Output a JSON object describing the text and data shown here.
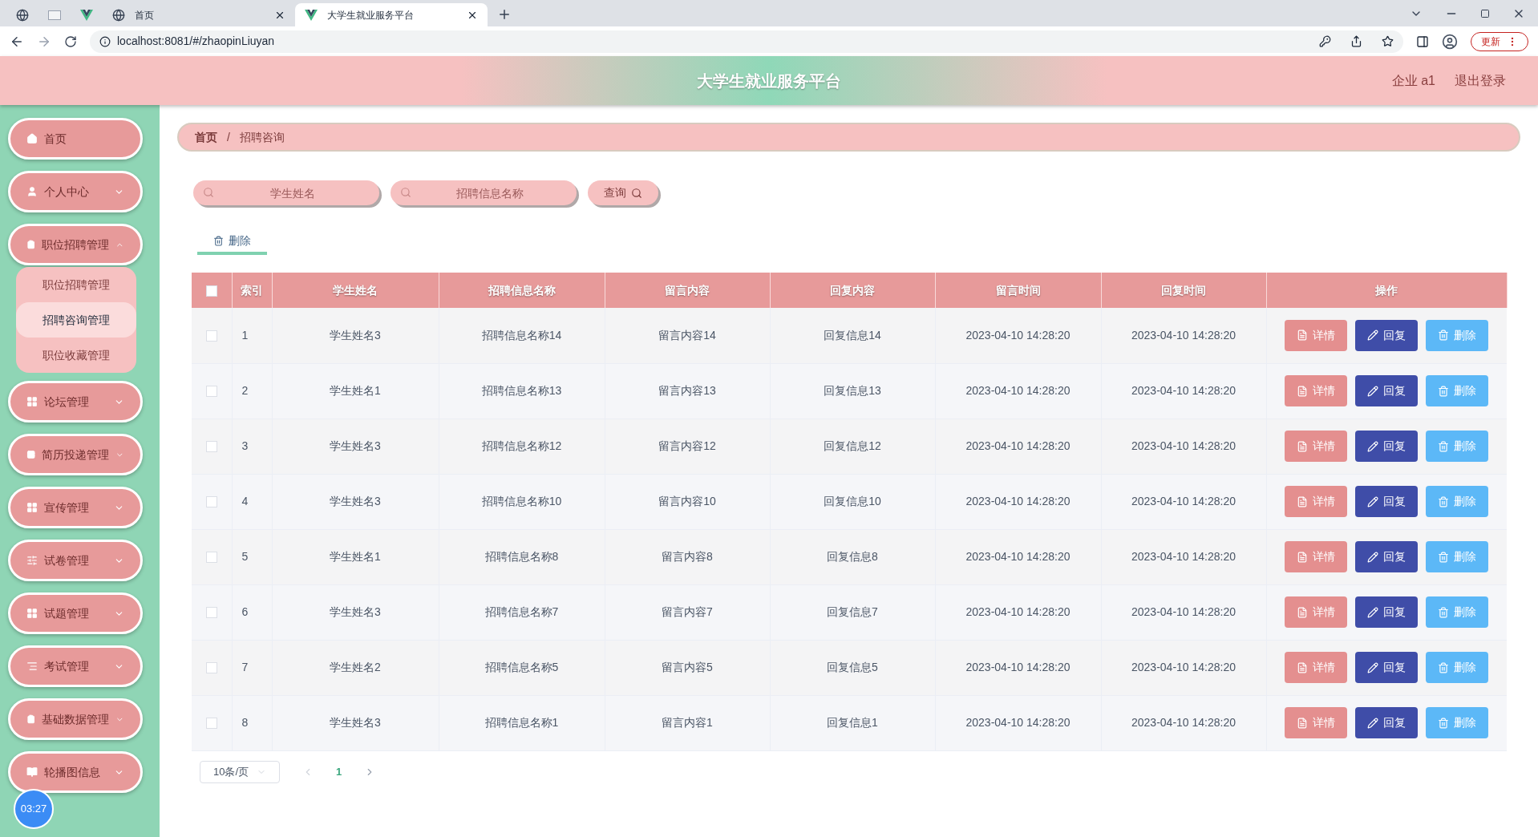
{
  "browser": {
    "tabs": [
      {
        "selected": false
      },
      {
        "selected": false
      },
      {
        "selected": false
      },
      {
        "title": "首页",
        "selected": false
      },
      {
        "title": "大学生就业服务平台",
        "selected": true
      }
    ],
    "url": "localhost:8081/#/zhaopinLiuyan",
    "update_button": "更新"
  },
  "header": {
    "title": "大学生就业服务平台",
    "user": "企业 a1",
    "logout": "退出登录"
  },
  "sidebar": {
    "items": [
      {
        "label": "首页"
      },
      {
        "label": "个人中心",
        "expanded": false
      },
      {
        "label": "职位招聘管理",
        "expanded": true,
        "children": [
          {
            "label": "职位招聘管理",
            "selected": false
          },
          {
            "label": "招聘咨询管理",
            "selected": true
          },
          {
            "label": "职位收藏管理",
            "selected": false
          }
        ]
      },
      {
        "label": "论坛管理",
        "expanded": false
      },
      {
        "label": "简历投递管理",
        "expanded": false
      },
      {
        "label": "宣传管理",
        "expanded": false
      },
      {
        "label": "试卷管理",
        "expanded": false
      },
      {
        "label": "试题管理",
        "expanded": false
      },
      {
        "label": "考试管理",
        "expanded": false
      },
      {
        "label": "基础数据管理",
        "expanded": false
      },
      {
        "label": "轮播图信息",
        "expanded": false
      }
    ],
    "clock": "03:27"
  },
  "breadcrumb": {
    "items": [
      "首页",
      "招聘咨询"
    ],
    "separator": "/"
  },
  "search": {
    "fields": [
      {
        "placeholder": "学生姓名"
      },
      {
        "placeholder": "招聘信息名称"
      }
    ],
    "button": "查询"
  },
  "toolbar": {
    "delete_button": "删除"
  },
  "table": {
    "columns": [
      "索引",
      "学生姓名",
      "招聘信息名称",
      "留言内容",
      "回复内容",
      "留言时间",
      "回复时间",
      "操作"
    ],
    "all_checked": false,
    "rows": [
      {
        "checked": false,
        "cells": [
          "1",
          "学生姓名3",
          "招聘信息名称14",
          "留言内容14",
          "回复信息14",
          "2023-04-10 14:28:20",
          "2023-04-10 14:28:20"
        ],
        "actions": [
          {
            "kind": "detail",
            "label": "详情"
          },
          {
            "kind": "reply",
            "label": "回复"
          },
          {
            "kind": "delete",
            "label": "删除"
          }
        ]
      },
      {
        "checked": false,
        "cells": [
          "2",
          "学生姓名1",
          "招聘信息名称13",
          "留言内容13",
          "回复信息13",
          "2023-04-10 14:28:20",
          "2023-04-10 14:28:20"
        ],
        "actions": [
          {
            "kind": "detail",
            "label": "详情"
          },
          {
            "kind": "reply",
            "label": "回复"
          },
          {
            "kind": "delete",
            "label": "删除"
          }
        ]
      },
      {
        "checked": false,
        "cells": [
          "3",
          "学生姓名3",
          "招聘信息名称12",
          "留言内容12",
          "回复信息12",
          "2023-04-10 14:28:20",
          "2023-04-10 14:28:20"
        ],
        "actions": [
          {
            "kind": "detail",
            "label": "详情"
          },
          {
            "kind": "reply",
            "label": "回复"
          },
          {
            "kind": "delete",
            "label": "删除"
          }
        ]
      },
      {
        "checked": false,
        "cells": [
          "4",
          "学生姓名3",
          "招聘信息名称10",
          "留言内容10",
          "回复信息10",
          "2023-04-10 14:28:20",
          "2023-04-10 14:28:20"
        ],
        "actions": [
          {
            "kind": "detail",
            "label": "详情"
          },
          {
            "kind": "reply",
            "label": "回复"
          },
          {
            "kind": "delete",
            "label": "删除"
          }
        ]
      },
      {
        "checked": false,
        "cells": [
          "5",
          "学生姓名1",
          "招聘信息名称8",
          "留言内容8",
          "回复信息8",
          "2023-04-10 14:28:20",
          "2023-04-10 14:28:20"
        ],
        "actions": [
          {
            "kind": "detail",
            "label": "详情"
          },
          {
            "kind": "reply",
            "label": "回复"
          },
          {
            "kind": "delete",
            "label": "删除"
          }
        ]
      },
      {
        "checked": false,
        "cells": [
          "6",
          "学生姓名3",
          "招聘信息名称7",
          "留言内容7",
          "回复信息7",
          "2023-04-10 14:28:20",
          "2023-04-10 14:28:20"
        ],
        "actions": [
          {
            "kind": "detail",
            "label": "详情"
          },
          {
            "kind": "reply",
            "label": "回复"
          },
          {
            "kind": "delete",
            "label": "删除"
          }
        ]
      },
      {
        "checked": false,
        "cells": [
          "7",
          "学生姓名2",
          "招聘信息名称5",
          "留言内容5",
          "回复信息5",
          "2023-04-10 14:28:20",
          "2023-04-10 14:28:20"
        ],
        "actions": [
          {
            "kind": "detail",
            "label": "详情"
          },
          {
            "kind": "reply",
            "label": "回复"
          },
          {
            "kind": "delete",
            "label": "删除"
          }
        ]
      },
      {
        "checked": false,
        "cells": [
          "8",
          "学生姓名3",
          "招聘信息名称1",
          "留言内容1",
          "回复信息1",
          "2023-04-10 14:28:20",
          "2023-04-10 14:28:20"
        ],
        "actions": [
          {
            "kind": "detail",
            "label": "详情"
          },
          {
            "kind": "reply",
            "label": "回复"
          },
          {
            "kind": "delete",
            "label": "删除"
          }
        ]
      }
    ]
  },
  "pagination": {
    "page_size": "10条/页",
    "pages": [
      {
        "label": "1",
        "selected": true
      }
    ]
  }
}
